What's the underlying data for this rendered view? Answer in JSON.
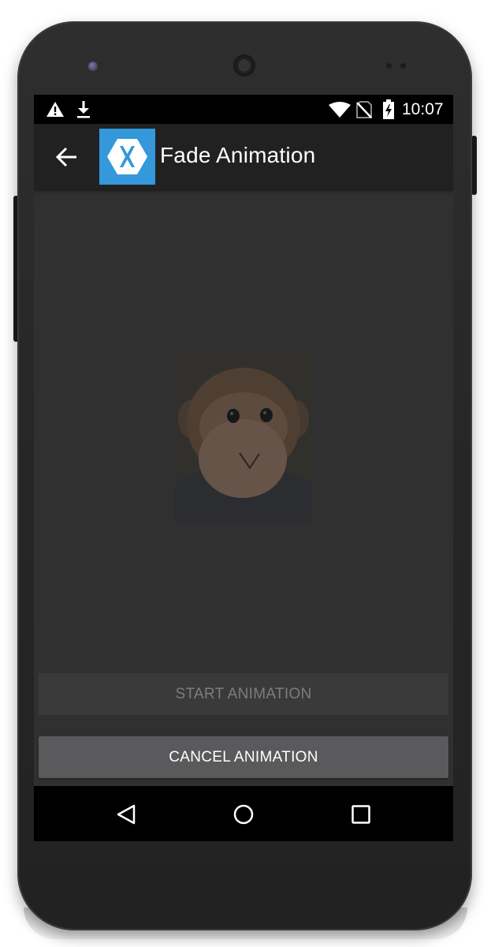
{
  "status_bar": {
    "time": "10:07",
    "icons": [
      "warning-icon",
      "download-icon",
      "wifi-icon",
      "no-sim-icon",
      "battery-charging-icon"
    ]
  },
  "app_bar": {
    "title": "Fade Animation",
    "back_icon": "arrow-back-icon",
    "logo_icon": "xamarin-logo-icon"
  },
  "content": {
    "image": "monkey-plush-image"
  },
  "buttons": {
    "start_label": "START ANIMATION",
    "start_enabled": false,
    "cancel_label": "CANCEL ANIMATION",
    "cancel_enabled": true
  },
  "nav_bar": {
    "icons": [
      "nav-back-icon",
      "nav-home-icon",
      "nav-recents-icon"
    ]
  },
  "colors": {
    "screen_background": "#303030",
    "app_bar": "#212121",
    "logo_blue": "#3498db",
    "button_disabled": "#3a3a3a",
    "button_enabled": "#5a5a5c"
  }
}
